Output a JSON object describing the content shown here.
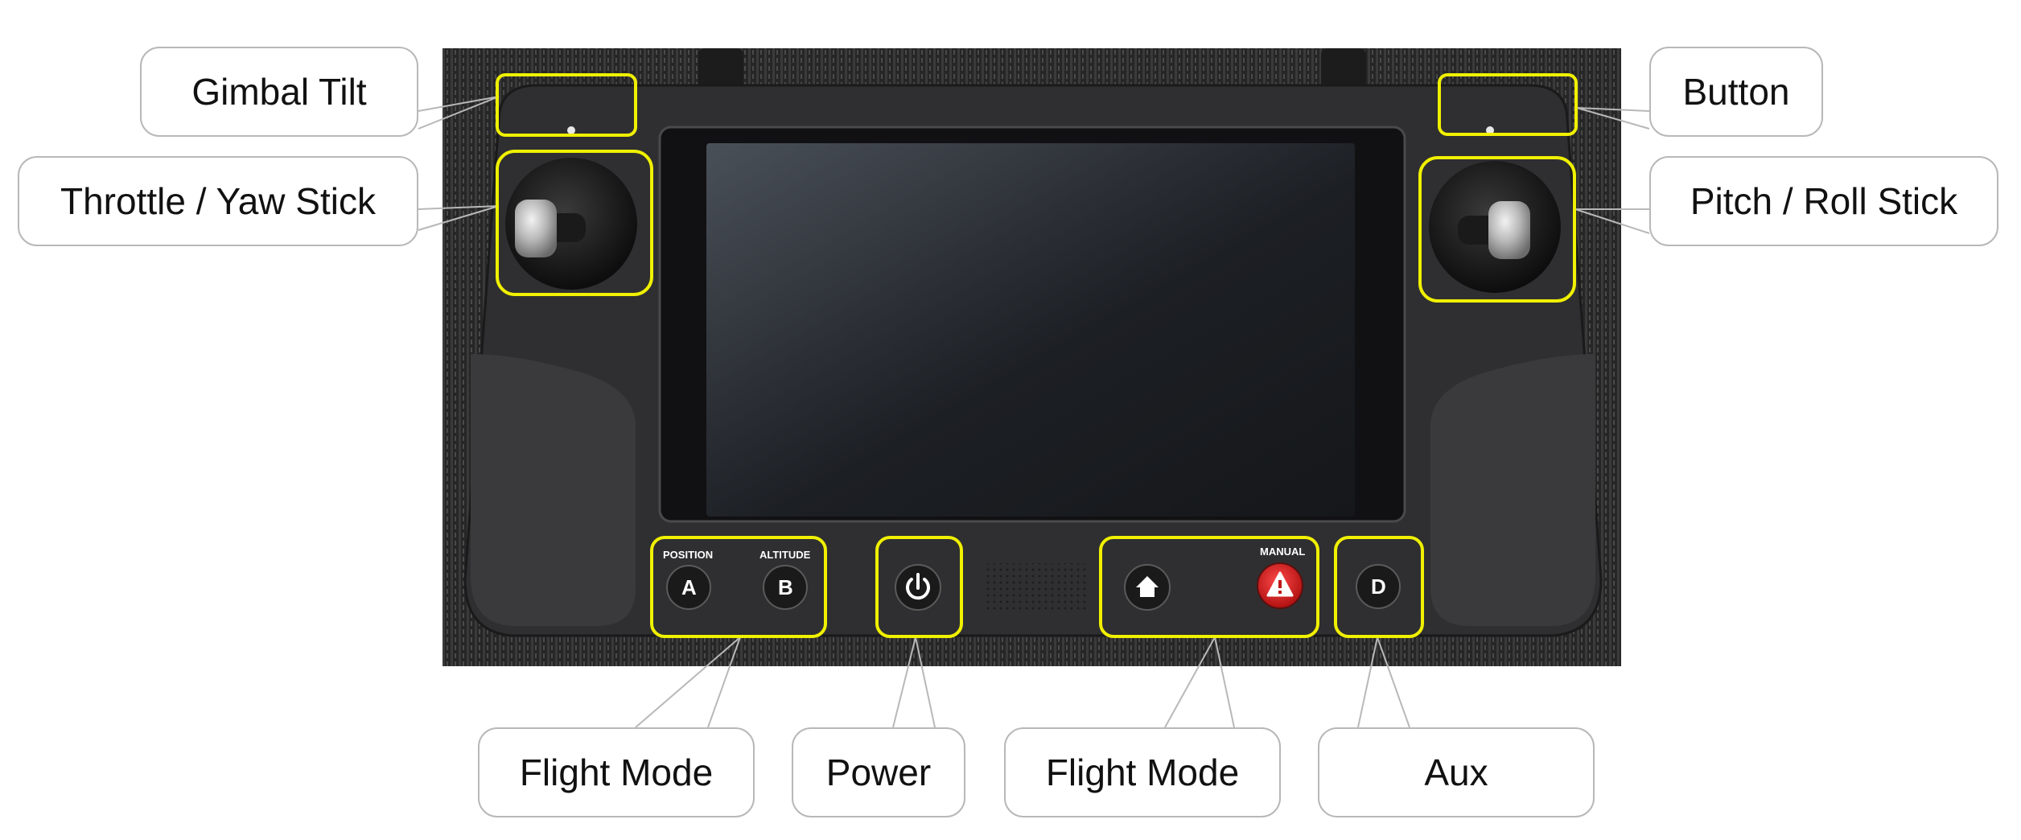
{
  "callouts": {
    "gimbal_tilt": "Gimbal Tilt",
    "button": "Button",
    "throttle_yaw": "Throttle / Yaw Stick",
    "pitch_roll": "Pitch / Roll Stick",
    "flight_mode_left": "Flight Mode",
    "power": "Power",
    "flight_mode_right": "Flight Mode",
    "aux": "Aux"
  },
  "device_labels": {
    "position": "POSITION",
    "altitude": "ALTITUDE",
    "manual": "MANUAL",
    "button_a": "A",
    "button_b": "B",
    "button_d": "D"
  },
  "colors": {
    "highlight": "#f0f000",
    "leader_line": "#b8b8b8",
    "warning_button": "#d42020",
    "carpet": "#2a2a2a",
    "controller_body": "#303030"
  },
  "icons": [
    "power-icon",
    "home-icon",
    "warning-icon"
  ]
}
